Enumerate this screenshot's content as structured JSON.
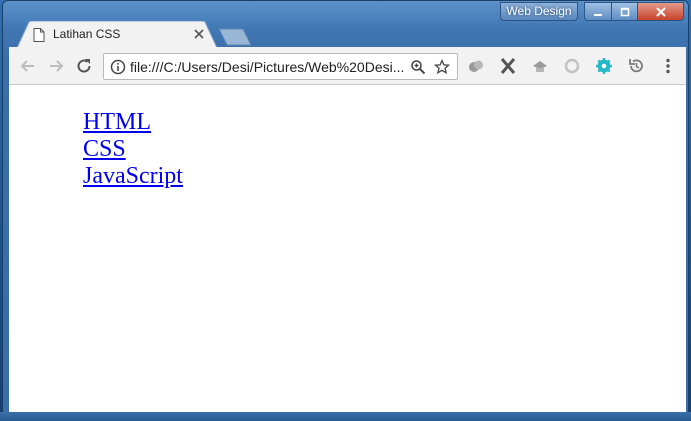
{
  "window": {
    "profile_label": "Web Design"
  },
  "tab": {
    "title": "Latihan CSS",
    "icon": "document-icon"
  },
  "toolbar": {
    "url": "file:///C:/Users/Desi/Pictures/Web%20Desi...",
    "extensions": [
      "extension-cloud-icon",
      "extension-x-icon",
      "extension-hat-icon",
      "extension-refresh-icon",
      "extension-gear-icon",
      "extension-history-icon"
    ]
  },
  "content": {
    "links": [
      "HTML",
      "CSS",
      "JavaScript"
    ]
  },
  "colors": {
    "link": "#0000ee",
    "frame": "#3a6ea8",
    "toolbar": "#f2f2f2"
  }
}
